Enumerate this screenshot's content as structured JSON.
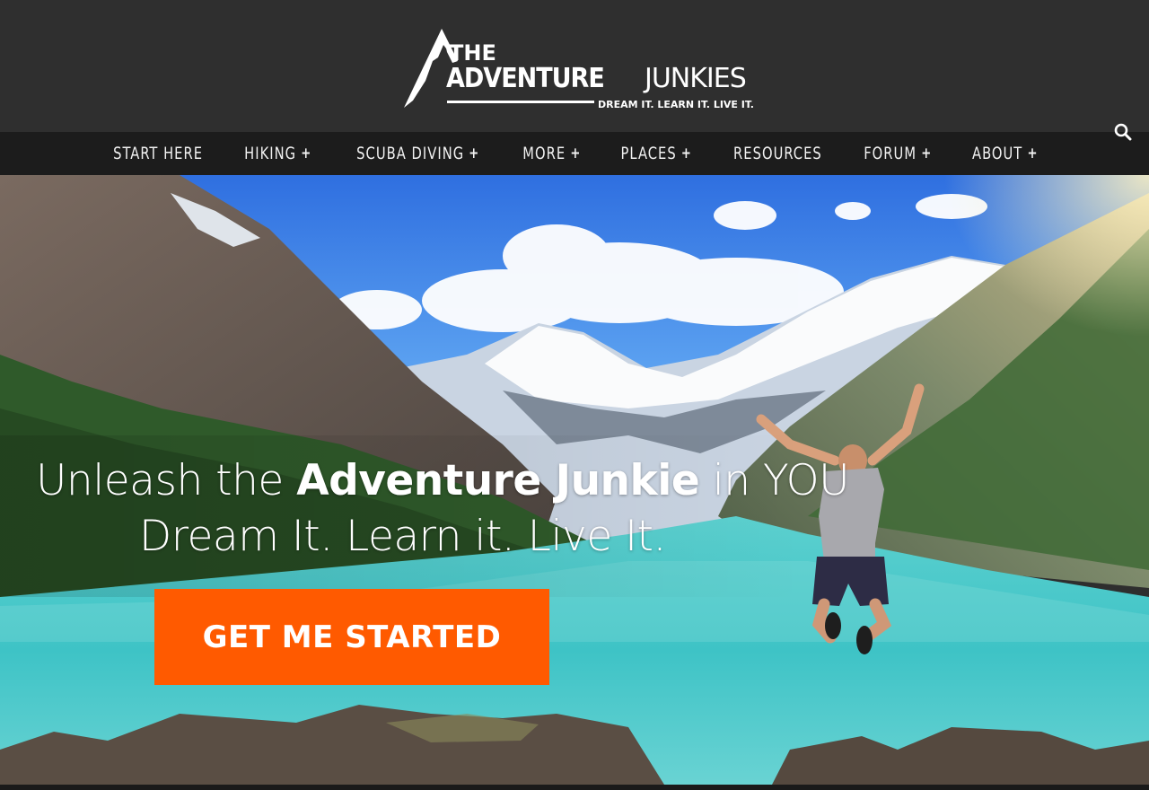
{
  "brand": {
    "line1": "THE",
    "line2a": "ADVENTURE",
    "line2b": "JUNKIES",
    "tagline": "DREAM IT. LEARN IT. LIVE IT."
  },
  "nav": {
    "items": [
      {
        "label": "START HERE",
        "has_submenu": false
      },
      {
        "label": "HIKING",
        "has_submenu": true
      },
      {
        "label": "SCUBA DIVING",
        "has_submenu": true
      },
      {
        "label": "MORE",
        "has_submenu": true
      },
      {
        "label": "PLACES",
        "has_submenu": true
      },
      {
        "label": "RESOURCES",
        "has_submenu": false
      },
      {
        "label": "FORUM",
        "has_submenu": true
      },
      {
        "label": "ABOUT",
        "has_submenu": true
      }
    ],
    "plus_symbol": "+",
    "search_icon": "search-icon"
  },
  "hero": {
    "headline_pre": "Unleash the ",
    "headline_bold": "Adventure Junkie",
    "headline_post": " in YOU",
    "subline": "Dream It. Learn it. Live It.",
    "cta_label": "GET ME STARTED"
  },
  "colors": {
    "header_bg": "#2f2f2f",
    "nav_bg": "#1c1c1c",
    "cta": "#ff5a00"
  }
}
